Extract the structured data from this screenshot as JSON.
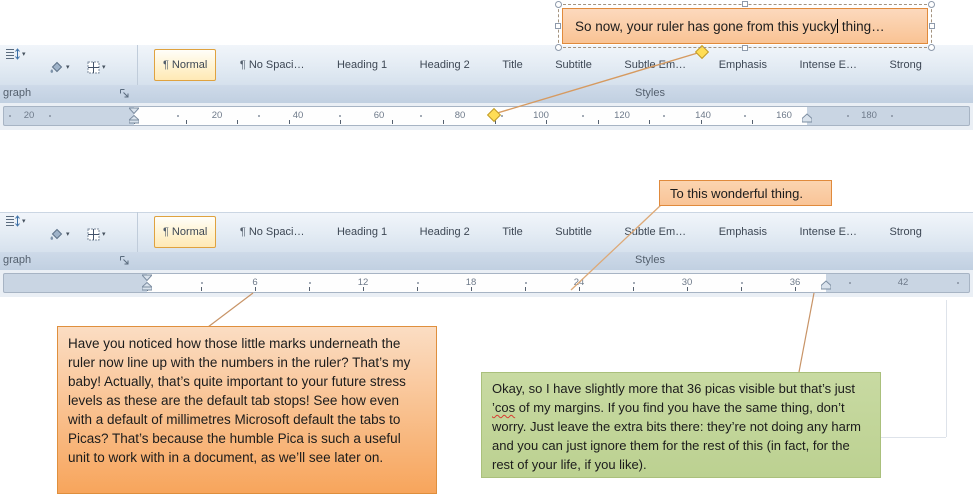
{
  "ribbon": {
    "paragraph_group_label_partial": "graph",
    "styles_group_label": "Styles",
    "styles": [
      {
        "label": "Normal",
        "pilcrow": "¶",
        "selected": true
      },
      {
        "label": "No Spaci…",
        "pilcrow": "¶"
      },
      {
        "label": "Heading 1"
      },
      {
        "label": "Heading 2"
      },
      {
        "label": "Title"
      },
      {
        "label": "Subtitle"
      },
      {
        "label": "Subtle Em…"
      },
      {
        "label": "Emphasis"
      },
      {
        "label": "Intense E…"
      },
      {
        "label": "Strong"
      }
    ]
  },
  "rulers": {
    "top": {
      "left_margin_number": "20",
      "numbers": [
        "20",
        "40",
        "60",
        "80",
        "100",
        "120",
        "140",
        "160"
      ],
      "right_margin_number": "180"
    },
    "bottom": {
      "numbers": [
        "6",
        "12",
        "18",
        "24",
        "30",
        "36",
        "42"
      ]
    }
  },
  "callouts": {
    "yucky": {
      "parts": [
        {
          "text": "So now, your ruler has gone from this yucky"
        },
        {
          "cursor": true
        },
        {
          "text": " thing…"
        }
      ]
    },
    "wonderful": {
      "text": "To this wonderful thing."
    },
    "tab_stops": {
      "text": "Have you noticed  how those little marks underneath the ruler now line up with the numbers in the ruler? That’s my baby! Actually, that’s quite important to your future stress levels as these are the default tab stops! See how even with a default of millimetres Microsoft default the tabs to Picas? That’s because the humble Pica is such a useful unit to work with in a document, as we’ll see later on."
    },
    "margins": {
      "parts": [
        {
          "text": "Okay, so I have slightly more that 36 picas visible but that’s just "
        },
        {
          "text": "’cos",
          "misspelled": true
        },
        {
          "text": " of my margins. If you find you have the same thing, don’t worry. Just leave the extra bits there: they’re not doing any harm and you can just ignore them for the rest of this (in fact, for the rest of your life, if you like)."
        }
      ]
    }
  },
  "icons": [
    "line-spacing-icon",
    "shading-icon",
    "borders-icon",
    "dialog-launcher-icon",
    "pilcrow-icon",
    "first-line-indent-marker",
    "hanging-indent-marker",
    "right-indent-marker",
    "tab-stop-marks",
    "selection-handle",
    "adjust-handle-diamond",
    "text-cursor"
  ],
  "colors": {
    "callout_orange_border": "#E08A3C",
    "callout_orange_light": "#FBDDC3",
    "callout_orange_deep": "#F7A55C",
    "callout_green": "#C3D69B",
    "selected_style_border": "#DFA23F",
    "leader_line": "#D69A60",
    "handle_yellow": "#FFDD55"
  }
}
